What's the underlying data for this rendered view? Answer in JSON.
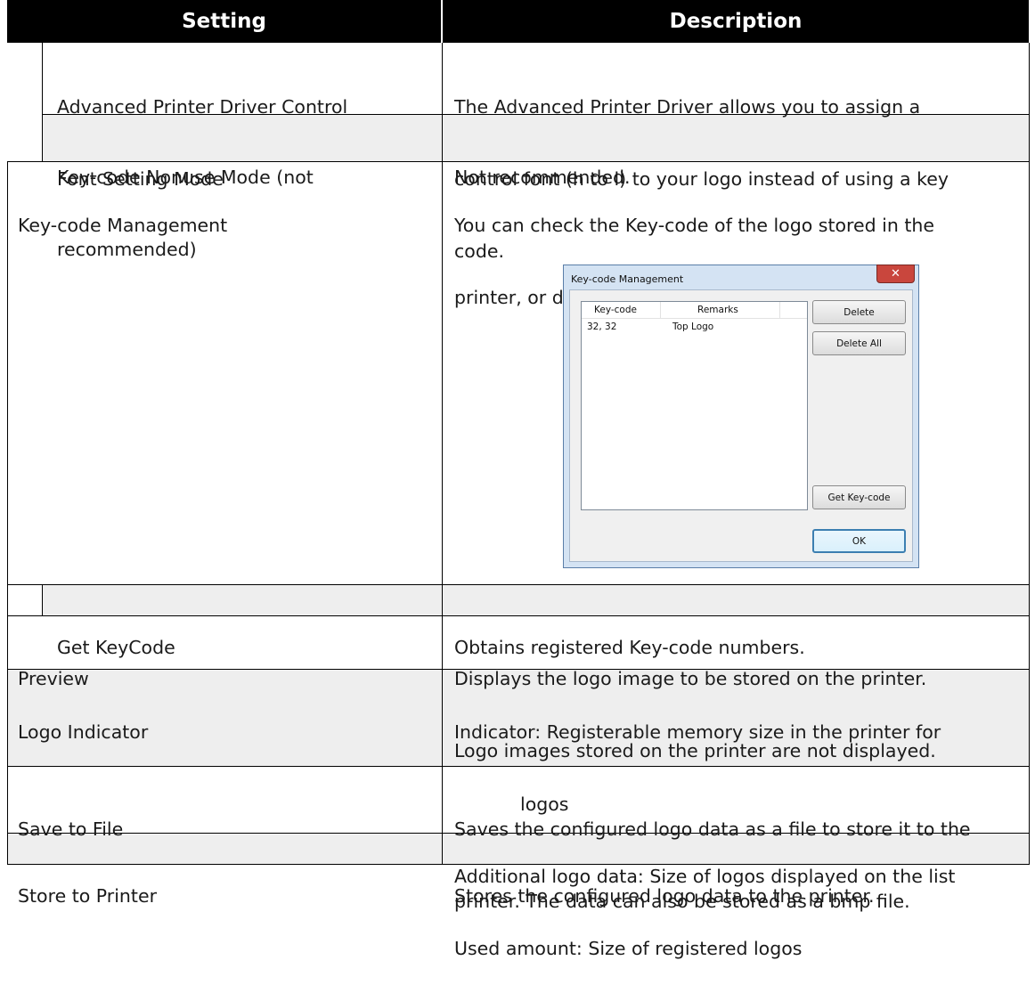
{
  "header": {
    "setting": "Setting",
    "description": "Description"
  },
  "rows": {
    "apd_control": {
      "setting": [
        "Advanced Printer Driver Control",
        "Font Setting Mode"
      ],
      "description": [
        "The Advanced Printer Driver allows you to assign a",
        "control font (h to l) to your logo instead of using a key",
        "code."
      ]
    },
    "keycode_nonuse": {
      "setting": [
        "Key-code Nonuse Mode (not",
        "recommended)"
      ],
      "description": [
        "Not recommended."
      ]
    },
    "keycode_management": {
      "setting": [
        "Key-code Management"
      ],
      "description": [
        "You can check the Key-code of the logo stored in the",
        "printer, or delete the logos."
      ]
    },
    "get_keycode": {
      "setting": [
        "Get KeyCode"
      ],
      "description": [
        "Obtains registered Key-code numbers."
      ]
    },
    "preview": {
      "setting": [
        "Preview"
      ],
      "description": [
        "Displays the logo image to be stored on the printer.",
        "Logo images stored on the printer are not displayed."
      ]
    },
    "logo_indicator": {
      "setting": [
        "Logo Indicator"
      ],
      "description": [
        "Indicator: Registerable memory size in the printer for",
        "logos",
        "Additional logo data: Size of logos displayed on the list",
        "Used amount: Size of registered logos"
      ]
    },
    "save_to_file": {
      "setting": [
        "Save to File"
      ],
      "description": [
        "Saves the configured logo data as a file to store it to the",
        "printer. The data can also be stored as a bmp file."
      ]
    },
    "store_to_printer": {
      "setting": [
        "Store to Printer"
      ],
      "description": [
        "Stores the configured logo data to the printer."
      ]
    }
  },
  "dialog": {
    "title": "Key-code Management",
    "close_glyph": "✕",
    "columns": [
      "Key-code",
      "Remarks"
    ],
    "list_rows": [
      {
        "keycode": "32, 32",
        "remarks": "Top Logo"
      }
    ],
    "buttons": {
      "delete": "Delete",
      "delete_all": "Delete All",
      "get_keycode": "Get Key-code",
      "ok": "OK"
    }
  }
}
